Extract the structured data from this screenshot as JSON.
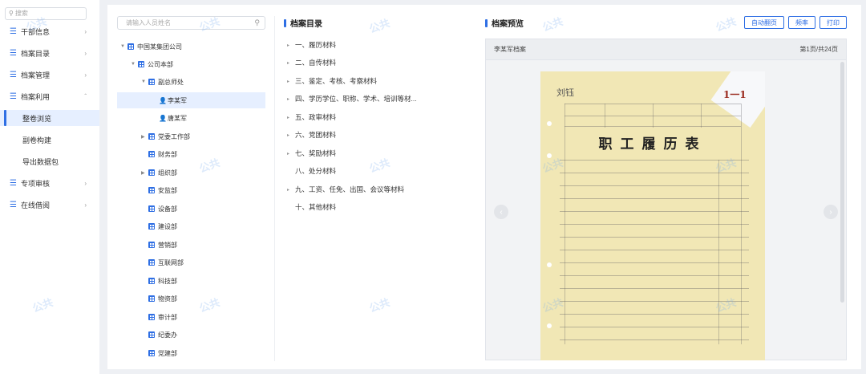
{
  "sidebar": {
    "search_placeholder": "搜索",
    "menu": [
      {
        "label": "干部信息"
      },
      {
        "label": "档案目录"
      },
      {
        "label": "档案管理"
      },
      {
        "label": "档案利用"
      }
    ],
    "sub_items": [
      {
        "label": "整卷浏览",
        "active": true
      },
      {
        "label": "副卷构建"
      },
      {
        "label": "导出数据包"
      }
    ],
    "menu_bottom": [
      {
        "label": "专项审核"
      },
      {
        "label": "在线借阅"
      }
    ]
  },
  "tree": {
    "search_placeholder": "请输入人员姓名",
    "nodes": [
      {
        "label": "中国某集团公司"
      },
      {
        "label": "公司本部"
      },
      {
        "label": "副总师处"
      },
      {
        "label": "李某军"
      },
      {
        "label": "唐某军"
      },
      {
        "label": "党委工作部"
      },
      {
        "label": "财务部"
      },
      {
        "label": "组织部"
      },
      {
        "label": "安监部"
      },
      {
        "label": "设备部"
      },
      {
        "label": "建设部"
      },
      {
        "label": "营销部"
      },
      {
        "label": "互联网部"
      },
      {
        "label": "科技部"
      },
      {
        "label": "物资部"
      },
      {
        "label": "审计部"
      },
      {
        "label": "纪委办"
      },
      {
        "label": "党建部"
      }
    ]
  },
  "catalog": {
    "title": "档案目录",
    "items": [
      {
        "label": "一、履历材料"
      },
      {
        "label": "二、自传材料"
      },
      {
        "label": "三、鉴定、考核、考察材料"
      },
      {
        "label": "四、学历学位、职称、学术、培训等材..."
      },
      {
        "label": "五、政审材料"
      },
      {
        "label": "六、党团材料"
      },
      {
        "label": "七、奖励材料"
      },
      {
        "label": "八、处分材料"
      },
      {
        "label": "九、工资、任免、出国、会议等材料"
      },
      {
        "label": "十、其他材料"
      }
    ]
  },
  "preview": {
    "title": "档案预览",
    "buttons": {
      "auto": "自动翻页",
      "rate": "频率",
      "print": "打印"
    },
    "doc_name": "李某军档案",
    "page_info": "第1页/共24页",
    "doc_title": "职工履历表",
    "handwriting": "刘钰",
    "stamp": "1一1"
  },
  "watermark": "公共"
}
